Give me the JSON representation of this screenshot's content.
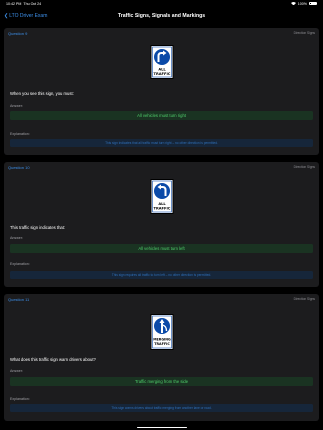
{
  "status": {
    "time": "10:42 PM",
    "date": "Thu Oct 24",
    "battery": "100%"
  },
  "nav": {
    "back_label": "LTO Driver Exam",
    "title": "Traffic Signs, Signals and Markings"
  },
  "cards": [
    {
      "number": "Question 9",
      "category": "Direction Signs",
      "sign_text": [
        "ALL",
        "TRAFFIC"
      ],
      "sign_icon": "turn-right-arrow-icon",
      "question": "When you see this sign, you must:",
      "answer_label": "Answer:",
      "answer": "All vehicles must turn right",
      "explanation_label": "Explanation:",
      "explanation": "This sign indicates that all traffic must turn right – no other direction is permitted."
    },
    {
      "number": "Question 10",
      "category": "Direction Signs",
      "sign_text": [
        "ALL",
        "TRAFFIC"
      ],
      "sign_icon": "turn-left-arrow-icon",
      "question": "This traffic sign indicates that:",
      "answer_label": "Answer:",
      "answer": "All vehicles must turn left",
      "explanation_label": "Explanation:",
      "explanation": "This sign requires all traffic to turn left – no other direction is permitted."
    },
    {
      "number": "Question 11",
      "category": "Direction Signs",
      "sign_text": [
        "MERGING",
        "TRAFFIC"
      ],
      "sign_icon": "merging-traffic-icon",
      "question": "What does this traffic sign warn drivers about?",
      "answer_label": "Answer:",
      "answer": "Traffic merging from the side",
      "explanation_label": "Explanation:",
      "explanation": "This sign warns drivers about traffic merging from another lane or road."
    }
  ]
}
